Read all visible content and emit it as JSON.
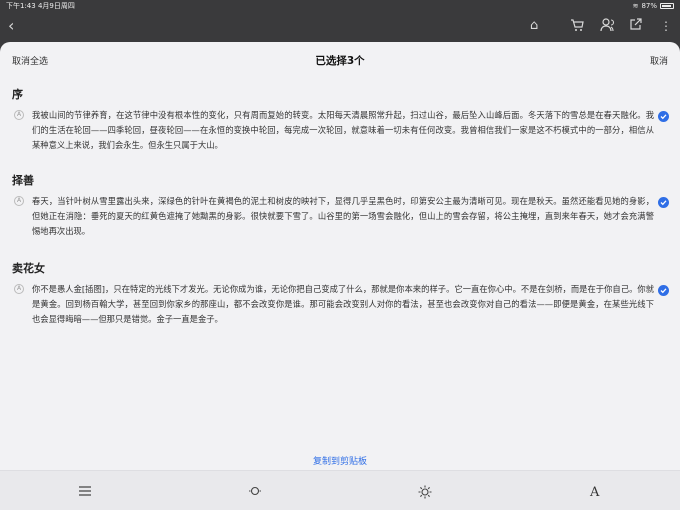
{
  "status": {
    "time_date": "下午1:43  4月9日周四",
    "battery": "87%"
  },
  "sheet": {
    "deselect_all": "取消全选",
    "title": "已选择3个",
    "cancel": "取消"
  },
  "sections": [
    {
      "title": "序",
      "body": "我被山间的节律养育，在这节律中没有根本性的变化，只有周而复始的转变。太阳每天清晨照常升起，扫过山谷，最后坠入山峰后面。冬天落下的雪总是在春天融化。我们的生活在轮回——四季轮回，昼夜轮回——在永恒的变换中轮回，每完成一次轮回，就意味着一切未有任何改变。我曾相信我们一家是这不朽模式中的一部分，相信从某种意义上来说，我们会永生。但永生只属于大山。"
    },
    {
      "title": "择善",
      "body": "春天，当针叶树从雪里露出头来，深绿色的针叶在黄褐色的泥土和树皮的映衬下，显得几乎呈黑色时，印第安公主最为清晰可见。现在是秋天。虽然还能看见她的身影，但她正在消隐：垂死的夏天的红黄色遮掩了她黝黑的身影。很快就要下雪了。山谷里的第一场雪会融化，但山上的雪会存留，将公主掩埋，直到来年春天，她才会充满警惕地再次出现。"
    },
    {
      "title": "卖花女",
      "body": "你不是愚人金[插图]，只在特定的光线下才发光。无论你成为谁，无论你把自己变成了什么，那就是你本来的样子。它一直在你心中。不是在剑桥，而是在于你自己。你就是黄金。回到杨百翰大学，甚至回到你家乡的那座山，都不会改变你是谁。那可能会改变别人对你的看法，甚至也会改变你对自己的看法——即便是黄金，在某些光线下也会显得晦暗——但那只是错觉。金子一直是金子。"
    }
  ],
  "actions": {
    "copy_to_clipboard": "复制到剪贴板"
  },
  "colors": {
    "accent": "#2f6ee6",
    "sheet_bg": "#f2f2f4"
  },
  "icons": {
    "toolbar": [
      "back-icon",
      "home-icon",
      "cart-icon",
      "people-icon",
      "share-icon",
      "more-icon"
    ],
    "bottom": [
      "list-icon",
      "brightness-low-icon",
      "brightness-high-icon",
      "font-icon"
    ]
  }
}
